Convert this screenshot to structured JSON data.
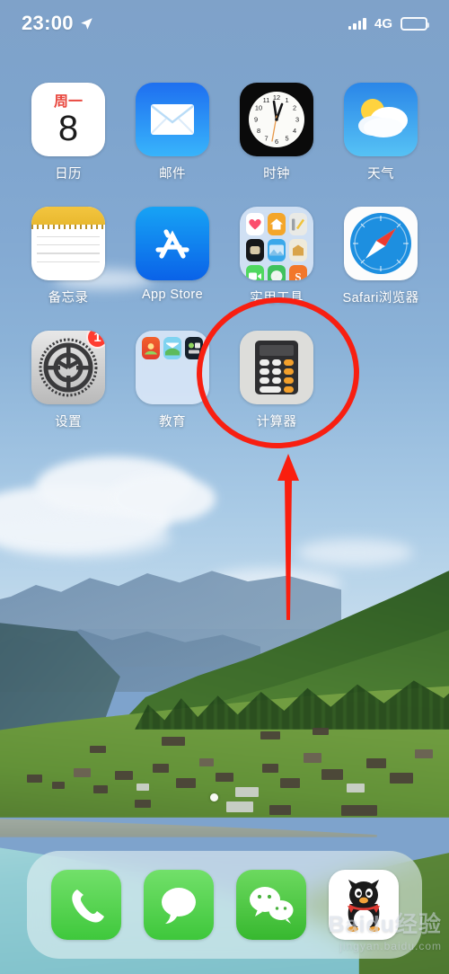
{
  "status_bar": {
    "time": "23:00",
    "location_icon": "location-arrow-icon",
    "signal_icon": "signal-bars-icon",
    "network": "4G",
    "battery_icon": "battery-icon",
    "battery_level_pct": 80
  },
  "home_screen": {
    "rows": [
      [
        {
          "name": "calendar",
          "label": "日历",
          "icon": "calendar-icon",
          "day_of_week": "周一",
          "day": "8",
          "badge": null
        },
        {
          "name": "mail",
          "label": "邮件",
          "icon": "mail-envelope-icon",
          "badge": null
        },
        {
          "name": "clock",
          "label": "时钟",
          "icon": "clock-icon",
          "badge": null
        },
        {
          "name": "weather",
          "label": "天气",
          "icon": "weather-sun-cloud-icon",
          "badge": null
        }
      ],
      [
        {
          "name": "notes",
          "label": "备忘录",
          "icon": "notes-icon",
          "badge": null
        },
        {
          "name": "app-store",
          "label": "App Store",
          "icon": "app-store-icon",
          "badge": null
        },
        {
          "name": "utilities-folder",
          "label": "实用工具",
          "icon": "folder-icon",
          "badge": null,
          "folder_items": [
            "health",
            "home",
            "measure",
            "watch",
            "photos",
            "books",
            "facetime",
            "compass",
            "sogou"
          ]
        },
        {
          "name": "safari",
          "label": "Safari浏览器",
          "icon": "safari-compass-icon",
          "badge": null
        }
      ],
      [
        {
          "name": "settings",
          "label": "设置",
          "icon": "gear-icon",
          "badge": "1"
        },
        {
          "name": "education-folder",
          "label": "教育",
          "icon": "folder-icon",
          "badge": null,
          "folder_items": [
            "app-a",
            "app-b",
            "app-c"
          ]
        },
        {
          "name": "calculator",
          "label": "计算器",
          "icon": "calculator-icon",
          "badge": null,
          "highlighted": true
        },
        {
          "name": "empty",
          "label": "",
          "icon": null,
          "badge": null
        }
      ]
    ]
  },
  "dock": {
    "items": [
      {
        "name": "phone",
        "label": "电话",
        "icon": "phone-handset-icon"
      },
      {
        "name": "messages",
        "label": "信息",
        "icon": "message-bubble-icon"
      },
      {
        "name": "wechat",
        "label": "微信",
        "icon": "wechat-bubbles-icon"
      },
      {
        "name": "qq",
        "label": "QQ",
        "icon": "qq-penguin-icon"
      }
    ]
  },
  "annotations": {
    "highlight_ellipse": {
      "target": "calculator",
      "color": "#f81f11",
      "shape": "ellipse"
    },
    "pointer_arrow": {
      "target": "calculator",
      "color": "#fa1e0e",
      "direction": "up"
    }
  },
  "page_indicator": {
    "pages": 1,
    "current": 1
  },
  "watermark": {
    "brand": "Baidu经验",
    "url": "jingyan.baidu.com"
  },
  "colors": {
    "accent_red": "#f81f11",
    "badge_red": "#ff3b30",
    "dock_green": "#3fc83c",
    "wallpaper_sky": "#7ea4cd"
  }
}
